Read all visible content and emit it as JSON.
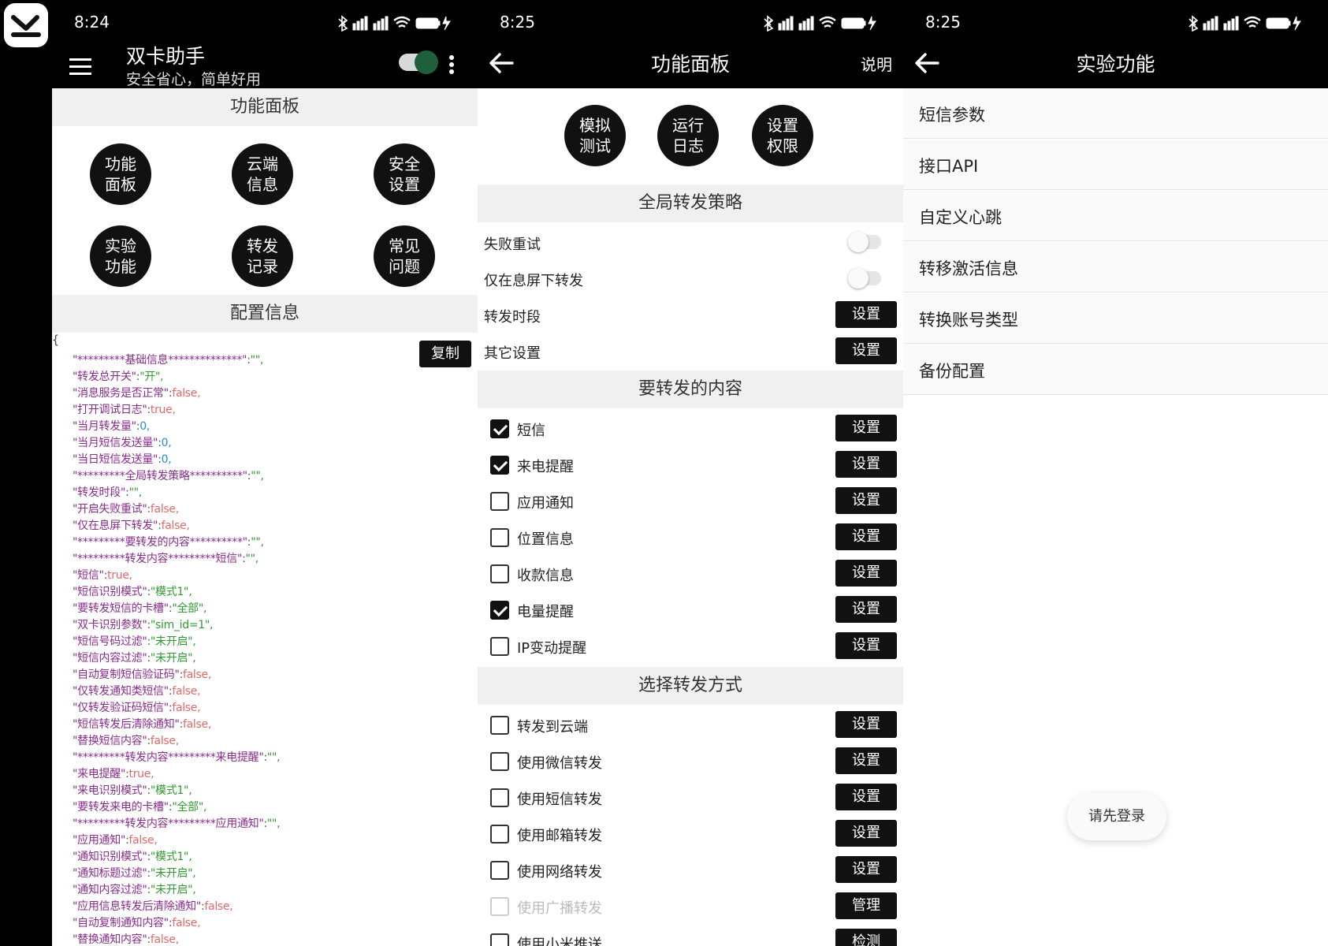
{
  "screen1": {
    "time": "8:24",
    "app_title": "双卡助手",
    "app_subtitle": "安全省心，简单好用",
    "panel_title": "功能面板",
    "grid": [
      {
        "l1": "功能",
        "l2": "面板"
      },
      {
        "l1": "云端",
        "l2": "信息"
      },
      {
        "l1": "安全",
        "l2": "设置"
      },
      {
        "l1": "实验",
        "l2": "功能"
      },
      {
        "l1": "转发",
        "l2": "记录"
      },
      {
        "l1": "常见",
        "l2": "问题"
      }
    ],
    "config_title": "配置信息",
    "brace": "{",
    "copy_label": "复制",
    "config_lines": [
      {
        "k": "\"*********基础信息**************\"",
        "v": "\"\",",
        "t": "s"
      },
      {
        "k": "\"转发总开关\"",
        "v": "\"开\",",
        "t": "s"
      },
      {
        "k": "\"消息服务是否正常\"",
        "v": "false,",
        "t": "b"
      },
      {
        "k": "\"打开调试日志\"",
        "v": "true,",
        "t": "b"
      },
      {
        "k": "\"当月转发量\"",
        "v": "0,",
        "t": "n"
      },
      {
        "k": "\"当月短信发送量\"",
        "v": "0,",
        "t": "n"
      },
      {
        "k": "\"当日短信发送量\"",
        "v": "0,",
        "t": "n"
      },
      {
        "k": "\"*********全局转发策略**********\"",
        "v": "\"\",",
        "t": "s"
      },
      {
        "k": "\"转发时段\"",
        "v": "\"\",",
        "t": "s"
      },
      {
        "k": "\"开启失败重试\"",
        "v": "false,",
        "t": "b"
      },
      {
        "k": "\"仅在息屏下转发\"",
        "v": "false,",
        "t": "b"
      },
      {
        "k": "\"*********要转发的内容**********\"",
        "v": "\"\",",
        "t": "s"
      },
      {
        "k": "\"*********转发内容*********短信\"",
        "v": "\"\",",
        "t": "s"
      },
      {
        "k": "\"短信\"",
        "v": "true,",
        "t": "b"
      },
      {
        "k": "\"短信识别模式\"",
        "v": "\"模式1\",",
        "t": "s"
      },
      {
        "k": "\"要转发短信的卡槽\"",
        "v": "\"全部\",",
        "t": "s"
      },
      {
        "k": "\"双卡识别参数\"",
        "v": "\"sim_id=1\",",
        "t": "s"
      },
      {
        "k": "\"短信号码过滤\"",
        "v": "\"未开启\",",
        "t": "s"
      },
      {
        "k": "\"短信内容过滤\"",
        "v": "\"未开启\",",
        "t": "s"
      },
      {
        "k": "\"自动复制短信验证码\"",
        "v": "false,",
        "t": "b"
      },
      {
        "k": "\"仅转发通知类短信\"",
        "v": "false,",
        "t": "b"
      },
      {
        "k": "\"仅转发验证码短信\"",
        "v": "false,",
        "t": "b"
      },
      {
        "k": "\"短信转发后清除通知\"",
        "v": "false,",
        "t": "b"
      },
      {
        "k": "\"替换短信内容\"",
        "v": "false,",
        "t": "b"
      },
      {
        "k": "\"*********转发内容*********来电提醒\"",
        "v": "\"\",",
        "t": "s"
      },
      {
        "k": "\"来电提醒\"",
        "v": "true,",
        "t": "b"
      },
      {
        "k": "\"来电识别模式\"",
        "v": "\"模式1\",",
        "t": "s"
      },
      {
        "k": "\"要转发来电的卡槽\"",
        "v": "\"全部\",",
        "t": "s"
      },
      {
        "k": "\"*********转发内容*********应用通知\"",
        "v": "\"\",",
        "t": "s"
      },
      {
        "k": "\"应用通知\"",
        "v": "false,",
        "t": "b"
      },
      {
        "k": "\"通知识别模式\"",
        "v": "\"模式1\",",
        "t": "s"
      },
      {
        "k": "\"通知标题过滤\"",
        "v": "\"未开启\",",
        "t": "s"
      },
      {
        "k": "\"通知内容过滤\"",
        "v": "\"未开启\",",
        "t": "s"
      },
      {
        "k": "\"应用信息转发后清除通知\"",
        "v": "false,",
        "t": "b"
      },
      {
        "k": "\"自动复制通知内容\"",
        "v": "false,",
        "t": "b"
      },
      {
        "k": "\"替换通知内容\"",
        "v": "false,",
        "t": "b"
      }
    ]
  },
  "screen2": {
    "time": "8:25",
    "title": "功能面板",
    "help_label": "说明",
    "circles": [
      {
        "l1": "模拟",
        "l2": "测试"
      },
      {
        "l1": "运行",
        "l2": "日志"
      },
      {
        "l1": "设置",
        "l2": "权限"
      }
    ],
    "section_strategy": "全局转发策略",
    "strategy_rows": [
      {
        "label": "失败重试",
        "kind": "switch"
      },
      {
        "label": "仅在息屏下转发",
        "kind": "switch"
      },
      {
        "label": "转发时段",
        "kind": "button",
        "btn": "设置"
      },
      {
        "label": "其它设置",
        "kind": "button",
        "btn": "设置"
      }
    ],
    "section_content": "要转发的内容",
    "content_rows": [
      {
        "label": "短信",
        "checked": true,
        "btn": "设置"
      },
      {
        "label": "来电提醒",
        "checked": true,
        "btn": "设置"
      },
      {
        "label": "应用通知",
        "checked": false,
        "btn": "设置"
      },
      {
        "label": "位置信息",
        "checked": false,
        "btn": "设置"
      },
      {
        "label": "收款信息",
        "checked": false,
        "btn": "设置"
      },
      {
        "label": "电量提醒",
        "checked": true,
        "btn": "设置"
      },
      {
        "label": "IP变动提醒",
        "checked": false,
        "btn": "设置"
      }
    ],
    "section_method": "选择转发方式",
    "method_rows": [
      {
        "label": "转发到云端",
        "checked": false,
        "btn": "设置"
      },
      {
        "label": "使用微信转发",
        "checked": false,
        "btn": "设置"
      },
      {
        "label": "使用短信转发",
        "checked": false,
        "btn": "设置"
      },
      {
        "label": "使用邮箱转发",
        "checked": false,
        "btn": "设置"
      },
      {
        "label": "使用网络转发",
        "checked": false,
        "btn": "设置"
      },
      {
        "label": "使用广播转发",
        "checked": false,
        "disabled": true,
        "btn": "管理"
      },
      {
        "label": "使用小米推送",
        "checked": false,
        "btn": "检测"
      }
    ]
  },
  "screen3": {
    "time": "8:25",
    "title": "实验功能",
    "items": [
      "短信参数",
      "接口API",
      "自定义心跳",
      "转移激活信息",
      "转换账号类型",
      "备份配置"
    ],
    "toast": "请先登录"
  },
  "colors": {
    "key": "#8a2c8c",
    "string": "#2e9b2e",
    "bool": "#e06a6a",
    "number": "#1f8fd0",
    "toggle_on": "#1f5f3c"
  }
}
